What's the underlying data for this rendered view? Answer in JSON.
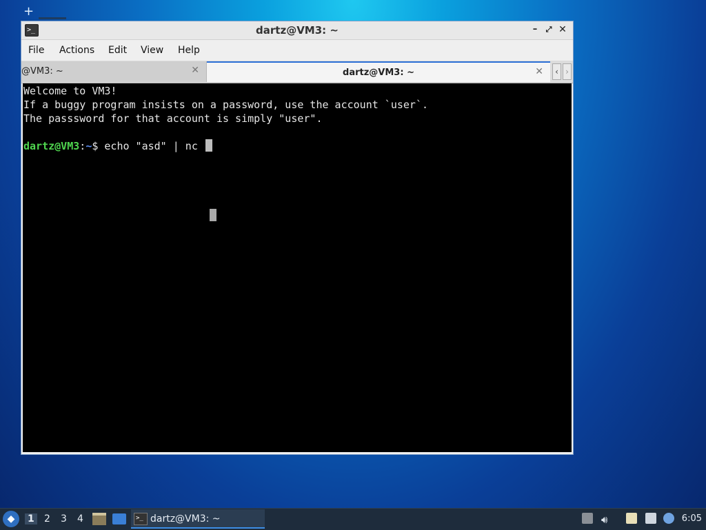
{
  "window": {
    "title": "dartz@VM3: ~",
    "icon": "terminal-icon",
    "controls": {
      "minimize": "–",
      "maximize": "⤢",
      "close": "✕"
    }
  },
  "menu": [
    "File",
    "Actions",
    "Edit",
    "View",
    "Help"
  ],
  "tabs": [
    {
      "label": "@VM3: ~",
      "active": false
    },
    {
      "label": "dartz@VM3: ~",
      "active": true
    }
  ],
  "tab_close_glyph": "✕",
  "tab_scroll": {
    "left": "‹",
    "right": "›"
  },
  "terminal": {
    "lines": [
      "Welcome to VM3!",
      "If a buggy program insists on a password, use the account `user`.",
      "The passsword for that account is simply \"user\"."
    ],
    "prompt_user": "dartz@VM3",
    "prompt_colon": ":",
    "prompt_path": "~",
    "prompt_symbol": "$ ",
    "command": "echo \"asd\" | nc "
  },
  "taskbar": {
    "workspaces": [
      "1",
      "2",
      "3",
      "4"
    ],
    "active_workspace": "1",
    "task_label": "dartz@VM3: ~",
    "clock": "6:05",
    "colors": {
      "accent": "#3d8ee6",
      "panel": "#1e2c3c"
    }
  }
}
